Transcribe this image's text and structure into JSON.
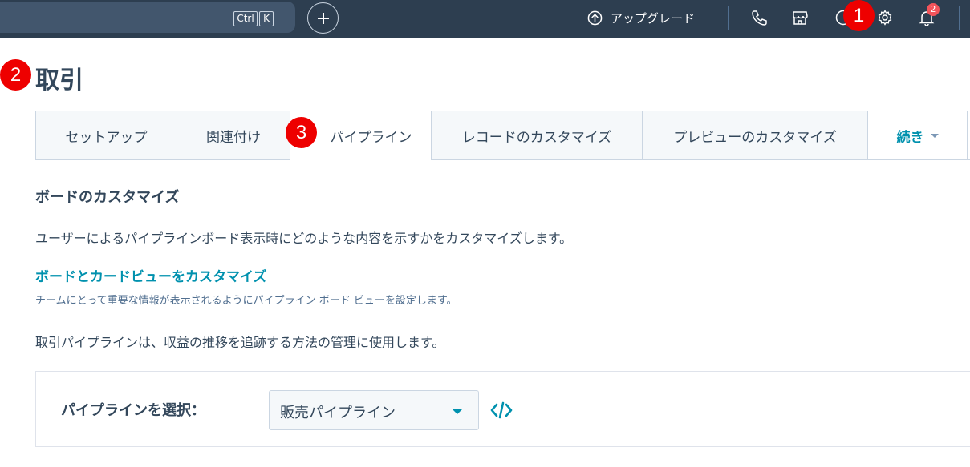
{
  "topbar": {
    "shortcut_ctrl": "Ctrl",
    "shortcut_k": "K",
    "upgrade_label": "アップグレード",
    "notification_count": "2",
    "icons": [
      "plus-icon",
      "upgrade-arrow-icon",
      "phone-icon",
      "marketplace-icon",
      "help-icon",
      "gear-icon",
      "bell-icon"
    ]
  },
  "markers": [
    "1",
    "2",
    "3"
  ],
  "page": {
    "title": "取引"
  },
  "tabs": [
    {
      "label": "セットアップ"
    },
    {
      "label": "関連付け"
    },
    {
      "label": "パイプライン"
    },
    {
      "label": "レコードのカスタマイズ"
    },
    {
      "label": "プレビューのカスタマイズ"
    },
    {
      "label": "続き"
    }
  ],
  "content": {
    "section_title": "ボードのカスタマイズ",
    "description": "ユーザーによるパイプラインボード表示時にどのような内容を示すかをカスタマイズします。",
    "link_label": "ボードとカードビューをカスタマイズ",
    "link_sub": "チームにとって重要な情報が表示されるようにパイプライン ボード ビューを設定します。",
    "description2": "取引パイプラインは、収益の推移を追跡する方法の管理に使用します。"
  },
  "pipeline_select": {
    "label": "パイプラインを選択：",
    "value": "販売パイプライン"
  },
  "colors": {
    "topbar": "#2d3e50",
    "accent": "#0091ae",
    "marker": "#ee0000",
    "text": "#33475b"
  }
}
